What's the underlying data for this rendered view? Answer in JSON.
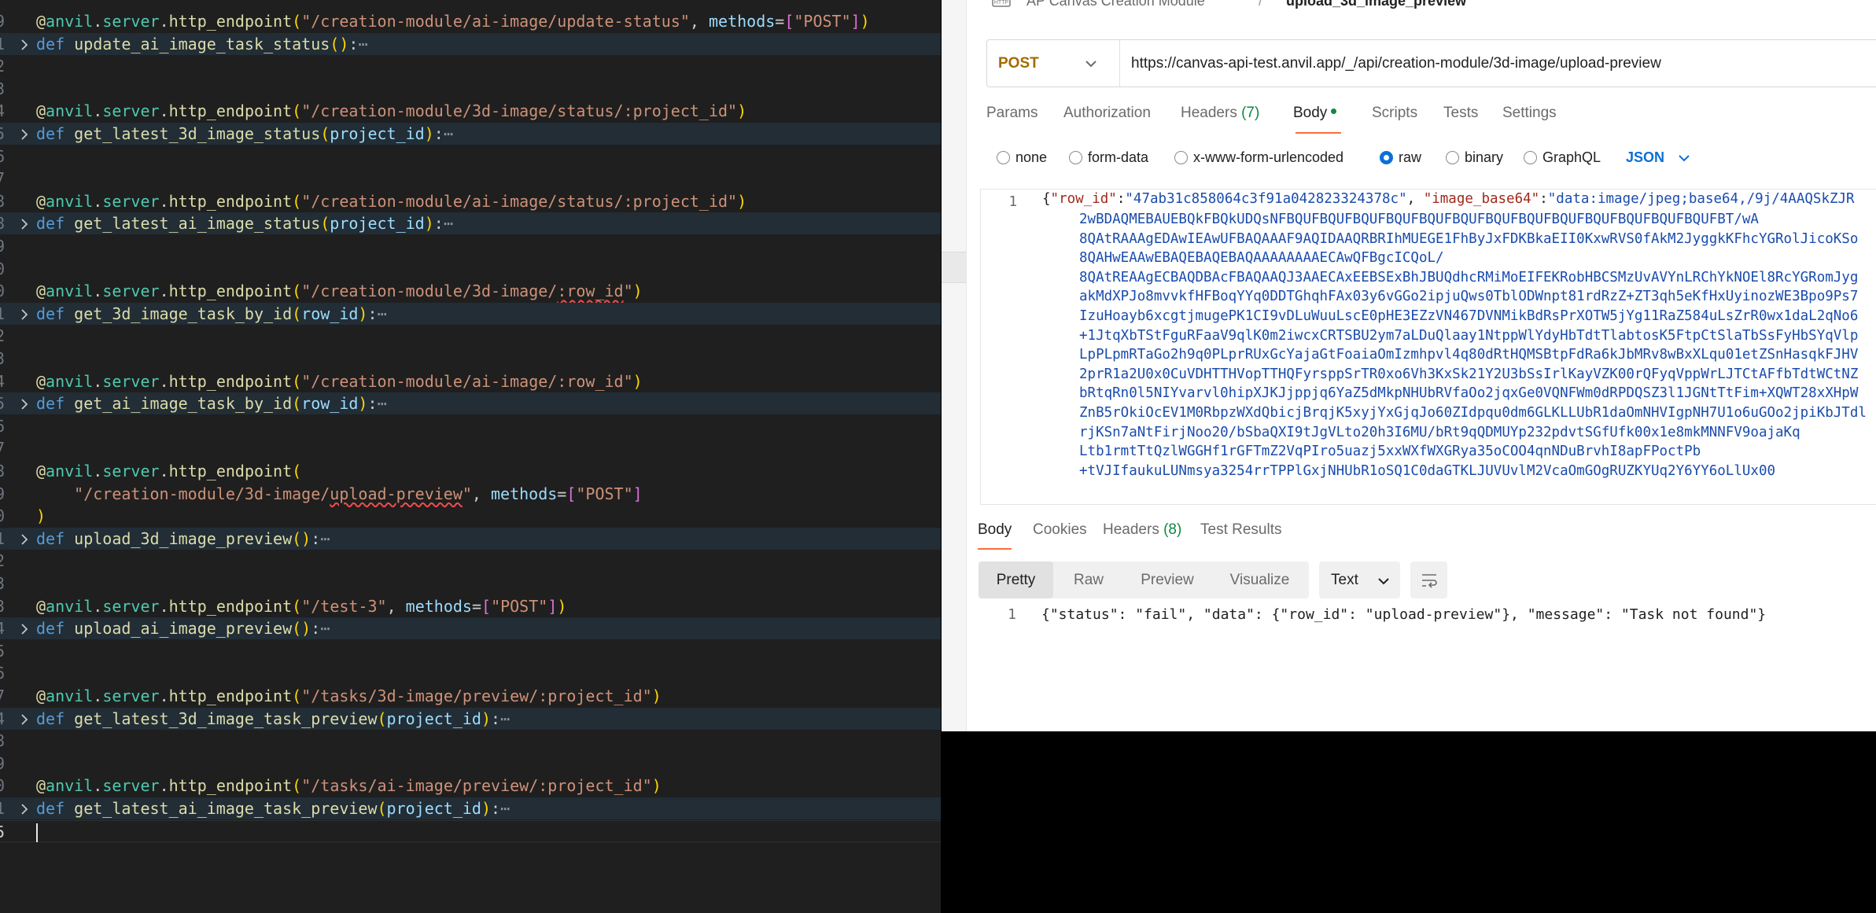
{
  "editor": {
    "lines": [
      {
        "num": "9",
        "parts": [
          [
            "tk-at",
            "@"
          ],
          [
            "tk-mod",
            "anvil"
          ],
          [
            "tk-punc",
            "."
          ],
          [
            "tk-mod",
            "server"
          ],
          [
            "tk-punc",
            "."
          ],
          [
            "tk-fn",
            "http_endpoint"
          ],
          [
            "tk-paren",
            "("
          ],
          [
            "tk-str",
            "\"/creation-module/ai-image/update-status\""
          ],
          [
            "tk-punc",
            ", "
          ],
          [
            "tk-key",
            "methods"
          ],
          [
            "tk-punc",
            "="
          ],
          [
            "tk-brk",
            "["
          ],
          [
            "tk-str",
            "\"POST\""
          ],
          [
            "tk-brk",
            "]"
          ],
          [
            "tk-paren",
            ")"
          ]
        ]
      },
      {
        "num": "1",
        "fold": true,
        "parts": [
          [
            "tk-kw",
            "def "
          ],
          [
            "tk-fn",
            "update_ai_image_task_status"
          ],
          [
            "tk-paren",
            "("
          ],
          [
            "tk-paren",
            ")"
          ],
          [
            "tk-punc",
            ":"
          ],
          [
            "tk-ell",
            "⋯"
          ]
        ]
      },
      {
        "num": "2",
        "parts": []
      },
      {
        "num": "3",
        "parts": []
      },
      {
        "num": "4",
        "parts": [
          [
            "tk-at",
            "@"
          ],
          [
            "tk-mod",
            "anvil"
          ],
          [
            "tk-punc",
            "."
          ],
          [
            "tk-mod",
            "server"
          ],
          [
            "tk-punc",
            "."
          ],
          [
            "tk-fn",
            "http_endpoint"
          ],
          [
            "tk-paren",
            "("
          ],
          [
            "tk-str",
            "\"/creation-module/3d-image/status/:project_id\""
          ],
          [
            "tk-paren",
            ")"
          ]
        ]
      },
      {
        "num": "5",
        "fold": true,
        "parts": [
          [
            "tk-kw",
            "def "
          ],
          [
            "tk-fn",
            "get_latest_3d_image_status"
          ],
          [
            "tk-paren",
            "("
          ],
          [
            "tk-param",
            "project_id"
          ],
          [
            "tk-paren",
            ")"
          ],
          [
            "tk-punc",
            ":"
          ],
          [
            "tk-ell",
            "⋯"
          ]
        ]
      },
      {
        "num": "6",
        "parts": []
      },
      {
        "num": "7",
        "parts": []
      },
      {
        "num": "8",
        "parts": [
          [
            "tk-at",
            "@"
          ],
          [
            "tk-mod",
            "anvil"
          ],
          [
            "tk-punc",
            "."
          ],
          [
            "tk-mod",
            "server"
          ],
          [
            "tk-punc",
            "."
          ],
          [
            "tk-fn",
            "http_endpoint"
          ],
          [
            "tk-paren",
            "("
          ],
          [
            "tk-str",
            "\"/creation-module/ai-image/status/:project_id\""
          ],
          [
            "tk-paren",
            ")"
          ]
        ]
      },
      {
        "num": "8",
        "fold": true,
        "parts": [
          [
            "tk-kw",
            "def "
          ],
          [
            "tk-fn",
            "get_latest_ai_image_status"
          ],
          [
            "tk-paren",
            "("
          ],
          [
            "tk-param",
            "project_id"
          ],
          [
            "tk-paren",
            ")"
          ],
          [
            "tk-punc",
            ":"
          ],
          [
            "tk-ell",
            "⋯"
          ]
        ]
      },
      {
        "num": "9",
        "parts": []
      },
      {
        "num": "0",
        "parts": []
      },
      {
        "num": "0",
        "parts": [
          [
            "tk-at",
            "@"
          ],
          [
            "tk-mod",
            "anvil"
          ],
          [
            "tk-punc",
            "."
          ],
          [
            "tk-mod",
            "server"
          ],
          [
            "tk-punc",
            "."
          ],
          [
            "tk-fn",
            "http_endpoint"
          ],
          [
            "tk-paren",
            "("
          ],
          [
            "tk-str",
            "\"/creation-module/3d-image/"
          ],
          [
            "tk-str squiggle",
            ":row_id"
          ],
          [
            "tk-str",
            "\""
          ],
          [
            "tk-paren",
            ")"
          ]
        ]
      },
      {
        "num": "1",
        "fold": true,
        "parts": [
          [
            "tk-kw",
            "def "
          ],
          [
            "tk-fn",
            "get_3d_image_task_by_id"
          ],
          [
            "tk-paren",
            "("
          ],
          [
            "tk-param",
            "row_id"
          ],
          [
            "tk-paren",
            ")"
          ],
          [
            "tk-punc",
            ":"
          ],
          [
            "tk-ell",
            "⋯"
          ]
        ]
      },
      {
        "num": "2",
        "parts": []
      },
      {
        "num": "3",
        "parts": []
      },
      {
        "num": "4",
        "parts": [
          [
            "tk-at",
            "@"
          ],
          [
            "tk-mod",
            "anvil"
          ],
          [
            "tk-punc",
            "."
          ],
          [
            "tk-mod",
            "server"
          ],
          [
            "tk-punc",
            "."
          ],
          [
            "tk-fn",
            "http_endpoint"
          ],
          [
            "tk-paren",
            "("
          ],
          [
            "tk-str",
            "\"/creation-module/ai-image/:row_id\""
          ],
          [
            "tk-paren",
            ")"
          ]
        ]
      },
      {
        "num": "5",
        "fold": true,
        "parts": [
          [
            "tk-kw",
            "def "
          ],
          [
            "tk-fn",
            "get_ai_image_task_by_id"
          ],
          [
            "tk-paren",
            "("
          ],
          [
            "tk-param",
            "row_id"
          ],
          [
            "tk-paren",
            ")"
          ],
          [
            "tk-punc",
            ":"
          ],
          [
            "tk-ell",
            "⋯"
          ]
        ]
      },
      {
        "num": "6",
        "parts": []
      },
      {
        "num": "7",
        "parts": []
      },
      {
        "num": "8",
        "parts": [
          [
            "tk-at",
            "@"
          ],
          [
            "tk-mod",
            "anvil"
          ],
          [
            "tk-punc",
            "."
          ],
          [
            "tk-mod",
            "server"
          ],
          [
            "tk-punc",
            "."
          ],
          [
            "tk-fn",
            "http_endpoint"
          ],
          [
            "tk-paren",
            "("
          ]
        ]
      },
      {
        "num": "9",
        "parts": [
          [
            "tk-punc",
            "    "
          ],
          [
            "tk-str",
            "\"/creation-module/3d-image/"
          ],
          [
            "tk-str squiggle",
            "upload-preview"
          ],
          [
            "tk-str",
            "\""
          ],
          [
            "tk-punc",
            ", "
          ],
          [
            "tk-key",
            "methods"
          ],
          [
            "tk-punc",
            "="
          ],
          [
            "tk-brk",
            "["
          ],
          [
            "tk-str",
            "\"POST\""
          ],
          [
            "tk-brk",
            "]"
          ]
        ]
      },
      {
        "num": "0",
        "parts": [
          [
            "tk-paren",
            ")"
          ]
        ]
      },
      {
        "num": "1",
        "fold": true,
        "parts": [
          [
            "tk-kw",
            "def "
          ],
          [
            "tk-fn",
            "upload_3d_image_preview"
          ],
          [
            "tk-paren",
            "("
          ],
          [
            "tk-paren",
            ")"
          ],
          [
            "tk-punc",
            ":"
          ],
          [
            "tk-ell",
            "⋯"
          ]
        ]
      },
      {
        "num": "2",
        "parts": []
      },
      {
        "num": "3",
        "parts": []
      },
      {
        "num": "3",
        "parts": [
          [
            "tk-at",
            "@"
          ],
          [
            "tk-mod",
            "anvil"
          ],
          [
            "tk-punc",
            "."
          ],
          [
            "tk-mod",
            "server"
          ],
          [
            "tk-punc",
            "."
          ],
          [
            "tk-fn",
            "http_endpoint"
          ],
          [
            "tk-paren",
            "("
          ],
          [
            "tk-str",
            "\"/test-3\""
          ],
          [
            "tk-punc",
            ", "
          ],
          [
            "tk-key",
            "methods"
          ],
          [
            "tk-punc",
            "="
          ],
          [
            "tk-brk",
            "["
          ],
          [
            "tk-str",
            "\"POST\""
          ],
          [
            "tk-brk",
            "]"
          ],
          [
            "tk-paren",
            ")"
          ]
        ]
      },
      {
        "num": "4",
        "fold": true,
        "parts": [
          [
            "tk-kw",
            "def "
          ],
          [
            "tk-fn",
            "upload_ai_image_preview"
          ],
          [
            "tk-paren",
            "("
          ],
          [
            "tk-paren",
            ")"
          ],
          [
            "tk-punc",
            ":"
          ],
          [
            "tk-ell",
            "⋯"
          ]
        ]
      },
      {
        "num": "5",
        "parts": []
      },
      {
        "num": "6",
        "parts": []
      },
      {
        "num": "7",
        "parts": [
          [
            "tk-at",
            "@"
          ],
          [
            "tk-mod",
            "anvil"
          ],
          [
            "tk-punc",
            "."
          ],
          [
            "tk-mod",
            "server"
          ],
          [
            "tk-punc",
            "."
          ],
          [
            "tk-fn",
            "http_endpoint"
          ],
          [
            "tk-paren",
            "("
          ],
          [
            "tk-str",
            "\"/tasks/3d-image/preview/:project_id\""
          ],
          [
            "tk-paren",
            ")"
          ]
        ]
      },
      {
        "num": "4",
        "fold": true,
        "parts": [
          [
            "tk-kw",
            "def "
          ],
          [
            "tk-fn",
            "get_latest_3d_image_task_preview"
          ],
          [
            "tk-paren",
            "("
          ],
          [
            "tk-param",
            "project_id"
          ],
          [
            "tk-paren",
            ")"
          ],
          [
            "tk-punc",
            ":"
          ],
          [
            "tk-ell",
            "⋯"
          ]
        ]
      },
      {
        "num": "8",
        "parts": []
      },
      {
        "num": "9",
        "parts": []
      },
      {
        "num": "0",
        "parts": [
          [
            "tk-at",
            "@"
          ],
          [
            "tk-mod",
            "anvil"
          ],
          [
            "tk-punc",
            "."
          ],
          [
            "tk-mod",
            "server"
          ],
          [
            "tk-punc",
            "."
          ],
          [
            "tk-fn",
            "http_endpoint"
          ],
          [
            "tk-paren",
            "("
          ],
          [
            "tk-str",
            "\"/tasks/ai-image/preview/:project_id\""
          ],
          [
            "tk-paren",
            ")"
          ]
        ]
      },
      {
        "num": "1",
        "fold": true,
        "parts": [
          [
            "tk-kw",
            "def "
          ],
          [
            "tk-fn",
            "get_latest_ai_image_task_preview"
          ],
          [
            "tk-paren",
            "("
          ],
          [
            "tk-param",
            "project_id"
          ],
          [
            "tk-paren",
            ")"
          ],
          [
            "tk-punc",
            ":"
          ],
          [
            "tk-ell",
            "⋯"
          ]
        ]
      },
      {
        "num": "5",
        "current": true,
        "parts": []
      }
    ]
  },
  "api": {
    "breadcrumb": {
      "collection": "AP Canvas Creation Module",
      "separator": "/",
      "request": "upload_3d_image_preview"
    },
    "method": "POST",
    "url": "https://canvas-api-test.anvil.app/_/api/creation-module/3d-image/upload-preview",
    "request_tabs": {
      "params": "Params",
      "authorization": "Authorization",
      "headers": "Headers",
      "headers_count": "(7)",
      "body": "Body",
      "scripts": "Scripts",
      "tests": "Tests",
      "settings": "Settings"
    },
    "body_types": {
      "none": "none",
      "form_data": "form-data",
      "urlencoded": "x-www-form-urlencoded",
      "raw": "raw",
      "binary": "binary",
      "graphql": "GraphQL",
      "selected": "raw"
    },
    "raw_format": "JSON",
    "request_body": {
      "line_number": "1",
      "first_line": {
        "open": "{",
        "key1": "\"row_id\"",
        "colon1": ":",
        "val1": "\"47ab31c858064c3f91a042823324378c\"",
        "comma": ", ",
        "key2": "\"image_base64\"",
        "colon2": ":",
        "val2_start": "\"data:image/jpeg;base64,/9j/4AAQSkZJR"
      },
      "continuation": [
        "2wBDAQMEBAUEBQkFBQkUDQsNFBQUFBQUFBQUFBQUFBQUFBQUFBQUFBQUFBQUFBQUFBQUFBQUFBQUFBT/wA",
        "8QAtRAAAgEDAwIEAwUFBAQAAAF9AQIDAAQRBRIhMUEGE1FhByJxFDKBkaEII0KxwRVS0fAkM2JyggkKFhcYGRolJicoKSo",
        "8QAHwEAAwEBAQEBAQEBAQAAAAAAAAECAwQFBgcICQoL/",
        "8QAtREAAgECBAQDBAcFBAQAAQJ3AAECAxEEBSExBhJBUQdhcRMiMoEIFEKRobHBCSMzUvAVYnLRChYkNOEl8RcYGRomJyg",
        "akMdXPJo8mvvkfHFBoqYYq0DDTGhqhFAx03y6vGGo2ipjuQws0TblODWnpt81rdRzZ+ZT3qh5eKfHxUyinozWE3Bpo9Ps7",
        "IzuHoayb6xcgtjmugePK1CI9vDLuWuuLscE0pHE3EZzVN467DVNMikBdRsPrXOTW5jYg11RaZ584uLsZrR0wx1daL2qNo6",
        "+1JtqXbTStFguRFaaV9qlK0m2iwcxCRTSBU2ym7aLDuQlaay1NtppWlYdyHbTdtTlabtosK5FtpCtSlaTbSsFyHbSYqVlp",
        "LpPLpmRTaGo2h9q0PLprRUxGcYajaGtFoaiaOmIzmhpvl4q80dRtHQMSBtpFdRa6kJbMRv8wBxXLqu01etZSnHasqkFJHV",
        "2prR1a2U0x0CuVDHTTHVopTTHQFyrsppSrTR0xo6Vh3KxSk21Y2U3bSsIrlKayVZK00rQFyqVppWrLJTCtAFfbTdtWCtNZ",
        "bRtqRn0l5NIYvarvl0hipXJKJjppjq6YaZ5dMkpNHUbRVfaOo2jqxGe0VQNFWm0dRPDQSZ3l1JGNtTtFim+XQWT28xXHpW",
        "ZnB5rOkiOcEV1M0RbpzWXdQbicjBrqjK5xyjYxGjqJo60ZIdpqu0dm6GLKLLUbR1daOmNHVIgpNH7U1o6uGOo2jpiKbJTdl",
        "rjKSn7aNtFirjNoo20/bSbaQXI9tJgVLto20h3I6MU/bRt9qQDMUYp232pdvtSGfUfk00x1e8mkMNNFV9oajaKq",
        "Ltb1rmtTtQzlWGGHf1rGFTmZ2VqPIro5uazj5xxWXfWXGRya35oCOO4qnNDuBrvhI8apFPoctPb",
        "+tVJIfaukuLUNmsya3254rrTPPlGxjNHUbR1oSQ1C0daGTKLJUVUvlM2VcaOmGOgRUZKYUq2Y6YY6oLlUx00"
      ]
    },
    "response_tabs": {
      "body": "Body",
      "cookies": "Cookies",
      "headers": "Headers",
      "headers_count": "(8)",
      "test_results": "Test Results"
    },
    "response_views": {
      "pretty": "Pretty",
      "raw": "Raw",
      "preview": "Preview",
      "visualize": "Visualize",
      "format": "Text"
    },
    "response_body": {
      "line_number": "1",
      "text": "{\"status\": \"fail\", \"data\": {\"row_id\": \"upload-preview\"}, \"message\": \"Task not found\"}"
    }
  }
}
